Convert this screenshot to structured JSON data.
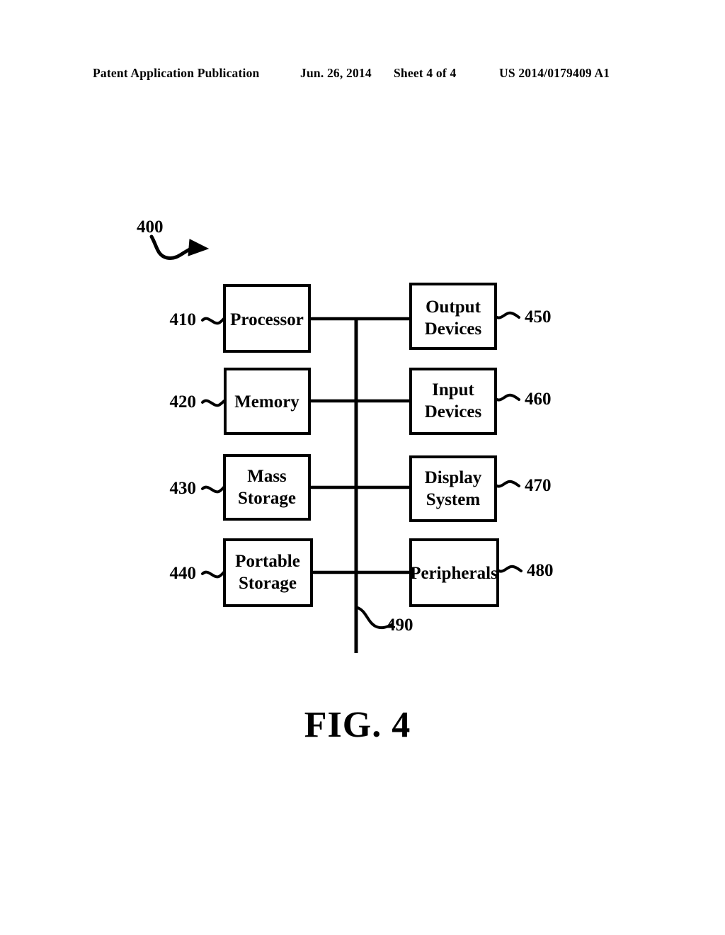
{
  "header": {
    "publication": "Patent Application Publication",
    "date": "Jun. 26, 2014",
    "sheet": "Sheet 4 of 4",
    "patent_number": "US 2014/0179409 A1"
  },
  "figure": {
    "caption": "FIG. 4",
    "system_ref": "400",
    "bus_ref": "490",
    "line_color": "#000000",
    "background_color": "#ffffff",
    "blocks": [
      {
        "id": "processor",
        "label_line1": "Processor",
        "label_line2": "",
        "ref": "410",
        "side": "left"
      },
      {
        "id": "memory",
        "label_line1": "Memory",
        "label_line2": "",
        "ref": "420",
        "side": "left"
      },
      {
        "id": "mass-storage",
        "label_line1": "Mass",
        "label_line2": "Storage",
        "ref": "430",
        "side": "left"
      },
      {
        "id": "portable-storage",
        "label_line1": "Portable",
        "label_line2": "Storage",
        "ref": "440",
        "side": "left"
      },
      {
        "id": "output-devices",
        "label_line1": "Output",
        "label_line2": "Devices",
        "ref": "450",
        "side": "right"
      },
      {
        "id": "input-devices",
        "label_line1": "Input",
        "label_line2": "Devices",
        "ref": "460",
        "side": "right"
      },
      {
        "id": "display-system",
        "label_line1": "Display",
        "label_line2": "System",
        "ref": "470",
        "side": "right"
      },
      {
        "id": "peripherals",
        "label_line1": "Peripherals",
        "label_line2": "",
        "ref": "480",
        "side": "right"
      }
    ]
  }
}
